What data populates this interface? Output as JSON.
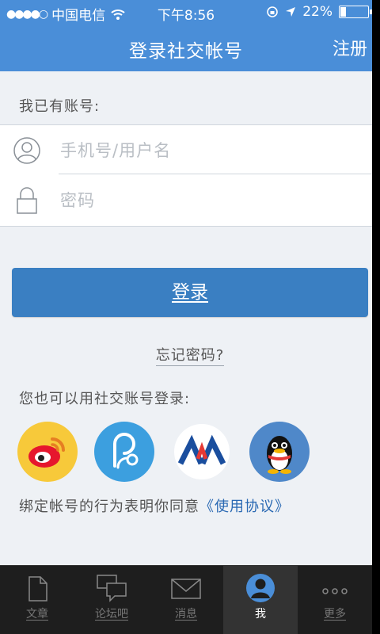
{
  "status_bar": {
    "signal": "●●●●○",
    "carrier": "中国电信",
    "time": "下午8:56",
    "battery": "22%",
    "battery_level": 0.22
  },
  "nav": {
    "title": "登录社交帐号",
    "register": "注册"
  },
  "login": {
    "have_account_label": "我已有账号:",
    "username_placeholder": "手机号/用户名",
    "password_placeholder": "密码",
    "login_button": "登录",
    "forgot_password": "忘记密码?"
  },
  "social": {
    "label": "您也可以用社交账号登录:",
    "providers": [
      "weibo-icon",
      "renren-icon",
      "kaixin-icon",
      "qq-icon"
    ]
  },
  "agreement": {
    "text": "绑定帐号的行为表明你同意",
    "link": "《使用协议》"
  },
  "tabs": [
    {
      "label": "文章",
      "icon": "document-icon"
    },
    {
      "label": "论坛吧",
      "icon": "chat-bubbles-icon"
    },
    {
      "label": "消息",
      "icon": "envelope-icon"
    },
    {
      "label": "我",
      "icon": "person-icon",
      "active": true
    },
    {
      "label": "更多",
      "icon": "more-icon"
    }
  ],
  "colors": {
    "accent": "#4a8ed8",
    "button": "#3a7fc2",
    "tabbar": "#1e1e1e"
  }
}
